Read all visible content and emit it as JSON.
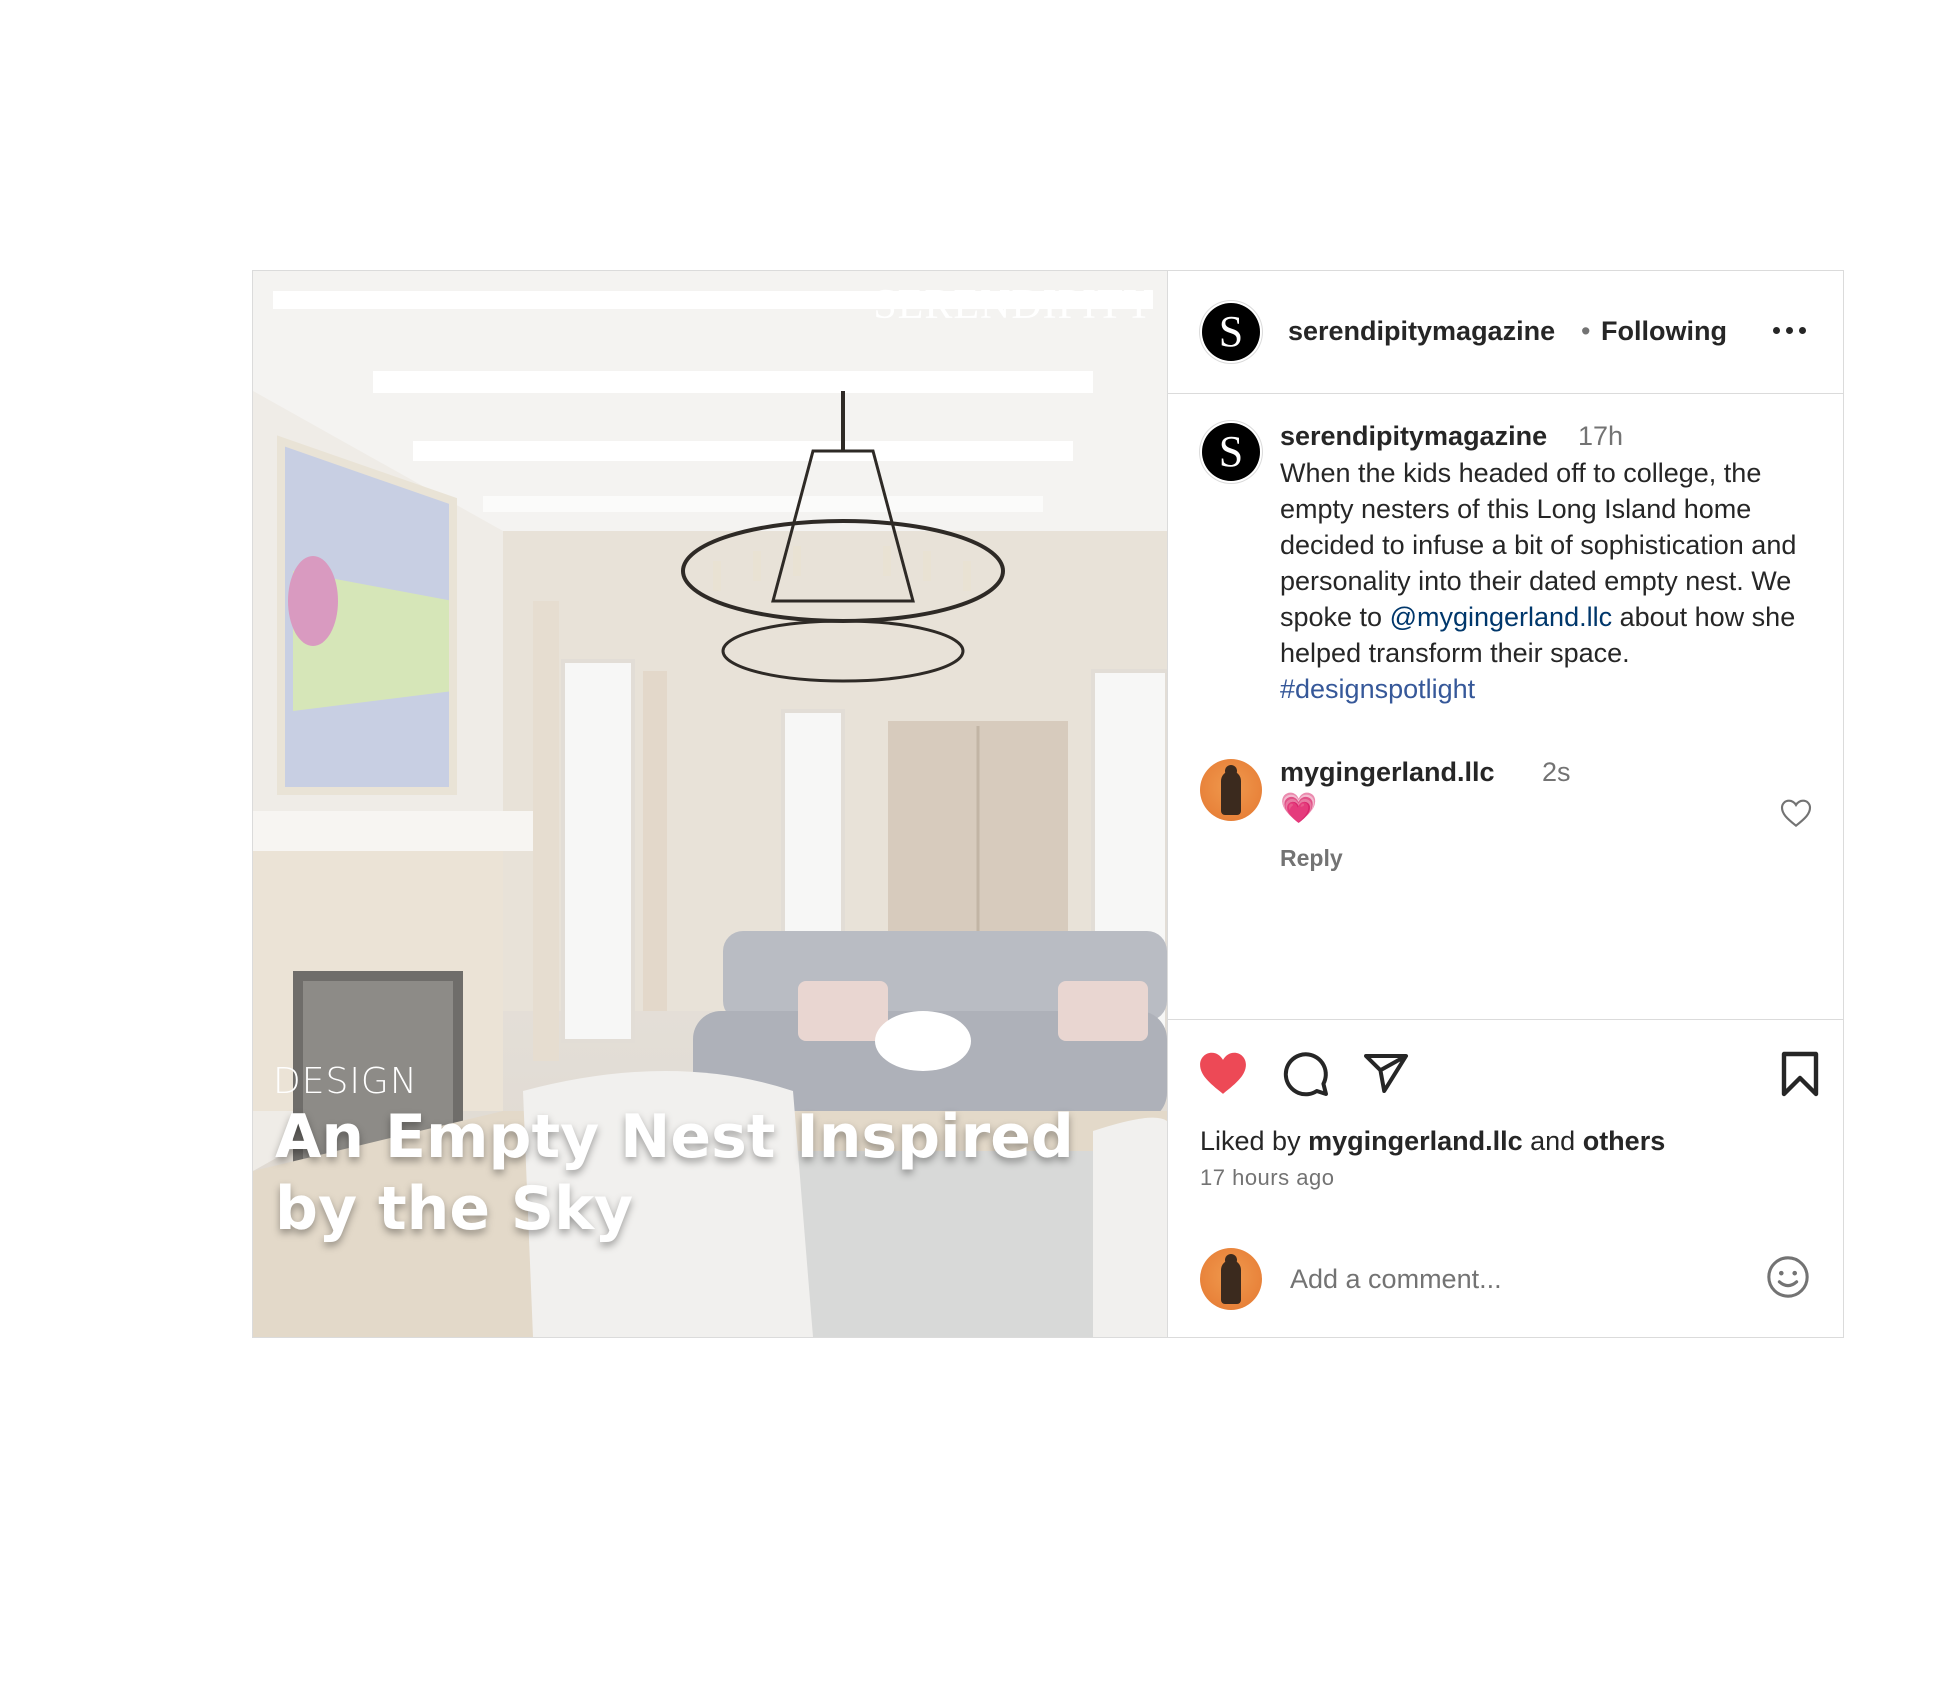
{
  "photo": {
    "brand": "SERENDIPITY",
    "kicker": "DESIGN",
    "headline": "An Empty Nest Inspired by the Sky"
  },
  "header": {
    "avatar_letter": "S",
    "username": "serendipitymagazine",
    "separator": "•",
    "follow_status": "Following",
    "more_icon": "more-horizontal-icon"
  },
  "caption": {
    "avatar_letter": "S",
    "username": "serendipitymagazine",
    "time": "17h",
    "text_before_mention": "When the kids headed off to college, the empty nesters of this Long Island home decided to infuse a bit of sophistication and personality into their dated empty nest. We spoke to ",
    "mention": "@mygingerland.llc",
    "text_after_mention": " about how she helped transform their space. ",
    "hashtag": "#designspotlight"
  },
  "comments": [
    {
      "username": "mygingerland.llc",
      "time": "2s",
      "text": "💗",
      "reply_label": "Reply"
    }
  ],
  "actions": {
    "like_color": "#ed4956",
    "liked_by_prefix": "Liked by ",
    "liked_by_user": "mygingerland.llc",
    "liked_by_mid": " and ",
    "liked_by_others": "others",
    "time_ago": "17 hours ago",
    "comment_placeholder": "Add a comment...",
    "icons": [
      "heart-filled-icon",
      "comment-icon",
      "share-icon",
      "bookmark-icon",
      "emoji-icon"
    ]
  }
}
